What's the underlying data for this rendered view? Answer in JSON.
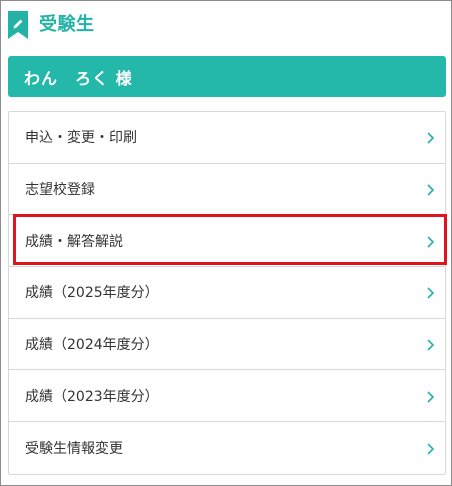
{
  "header": {
    "title": "受験生",
    "icon": "pencil-badge-icon"
  },
  "user": {
    "name": "わん　ろく 様"
  },
  "menu": {
    "items": [
      {
        "label": "申込・変更・印刷"
      },
      {
        "label": "志望校登録"
      },
      {
        "label": "成績・解答解説"
      },
      {
        "label": "成績（2025年度分）"
      },
      {
        "label": "成績（2024年度分）"
      },
      {
        "label": "成績（2023年度分）"
      },
      {
        "label": "受験生情報変更"
      }
    ],
    "chevron_icon": "chevron-right-icon",
    "highlighted_index": 2
  },
  "colors": {
    "accent": "#23b8a9",
    "highlight": "#e0141c",
    "text": "#333333",
    "border": "#d8d8d8"
  }
}
